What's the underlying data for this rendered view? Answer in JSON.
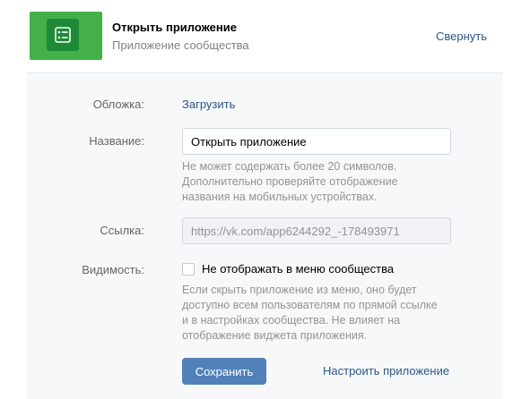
{
  "header": {
    "app_title": "Открыть приложение",
    "app_subtitle": "Приложение сообщества",
    "collapse_label": "Свернуть",
    "icon": "app-form-icon"
  },
  "form": {
    "cover": {
      "label": "Обложка:",
      "action": "Загрузить"
    },
    "name": {
      "label": "Название:",
      "value": "Открыть приложение",
      "hint_lines": [
        "Не может содержать более 20 символов.",
        "Дополнительно проверяйте отображение",
        "названия на мобильных устройствах."
      ]
    },
    "link": {
      "label": "Ссылка:",
      "value": "https://vk.com/app6244292_-178493971"
    },
    "visibility": {
      "label": "Видимость:",
      "checkbox_label": "Не отображать в меню сообщества",
      "checked": false,
      "hint_lines": [
        "Если скрыть приложение из меню, оно будет",
        "доступно всем пользователям по прямой ссылке",
        "и в настройках сообщества. Не влияет на",
        "отображение виджета приложения."
      ]
    },
    "save_label": "Сохранить",
    "configure_label": "Настроить приложение"
  },
  "colors": {
    "accent": "#5181b8",
    "link": "#2a5885",
    "icon_bg": "#43b04a",
    "panel_bg": "#f7f8fa"
  }
}
